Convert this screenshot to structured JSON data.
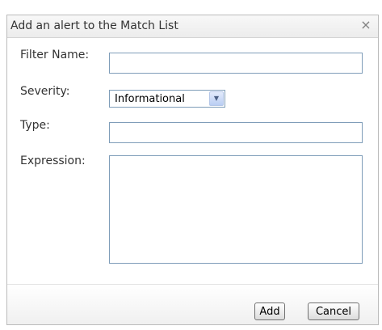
{
  "dialog": {
    "title": "Add an alert to the Match List",
    "close_glyph": "×"
  },
  "form": {
    "filter_name": {
      "label": "Filter Name:",
      "value": ""
    },
    "severity": {
      "label": "Severity:",
      "selected": "Informational"
    },
    "type": {
      "label": "Type:",
      "value": ""
    },
    "expression": {
      "label": "Expression:",
      "value": ""
    }
  },
  "buttons": {
    "add_label": "Add",
    "cancel_label": "Cancel"
  },
  "icons": {
    "close": "close-icon",
    "dropdown": "chevron-down-icon"
  },
  "colors": {
    "input_border": "#7f9db9",
    "dropdown_arrow_bg": "#b9cdf3"
  }
}
